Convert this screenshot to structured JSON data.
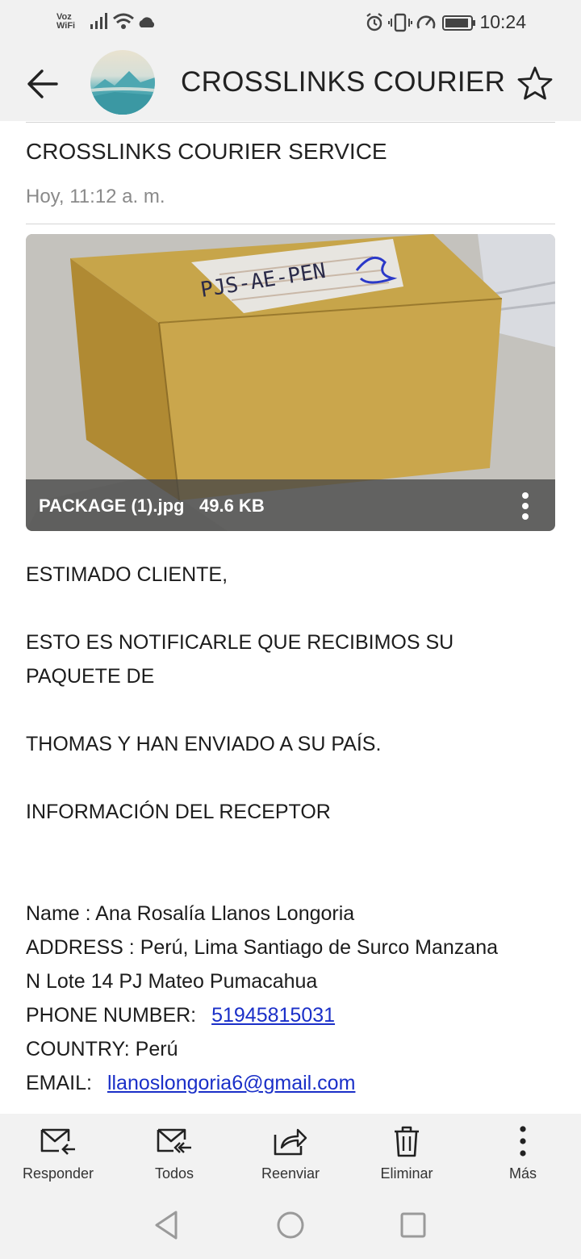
{
  "status_bar": {
    "voz_label": "Voz",
    "wifi_label": "WiFi",
    "time": "10:24"
  },
  "header": {
    "title": "CROSSLINKS COURIER",
    "back_icon": "arrow-left-icon",
    "star_icon": "star-outline-icon"
  },
  "email": {
    "subject": "CROSSLINKS COURIER SERVICE",
    "date": "Hoy, 11:12 a. m.",
    "attachment": {
      "name": "PACKAGE (1).jpg",
      "size": "49.6 KB",
      "handwriting": "PJS-AE-PEN"
    },
    "body": {
      "greeting": "ESTIMADO CLIENTE,",
      "line1": "ESTO ES NOTIFICARLE QUE RECIBIMOS SU",
      "line2": "PAQUETE DE",
      "line3": "THOMAS  Y HAN ENVIADO A SU PAÍS.",
      "info_heading": "INFORMACIÓN DEL RECEPTOR",
      "name_line": "Name : Ana Rosalía Llanos Longoria",
      "address_line1": "ADDRESS :  Perú, Lima Santiago de Surco Manzana",
      "address_line2": "N Lote 14 PJ Mateo Pumacahua",
      "phone_label": "PHONE NUMBER:",
      "phone_value": "51945815031",
      "country_line": "COUNTRY:  Perú",
      "email_label": "EMAIL:",
      "email_value": "llanoslongoria6@gmail.com"
    }
  },
  "actions": [
    {
      "label": "Responder",
      "icon": "reply-icon"
    },
    {
      "label": "Todos",
      "icon": "reply-all-icon"
    },
    {
      "label": "Reenviar",
      "icon": "forward-icon"
    },
    {
      "label": "Eliminar",
      "icon": "trash-icon"
    },
    {
      "label": "Más",
      "icon": "more-vertical-icon"
    }
  ],
  "nav": [
    "back-triangle-icon",
    "home-circle-icon",
    "recents-square-icon"
  ]
}
